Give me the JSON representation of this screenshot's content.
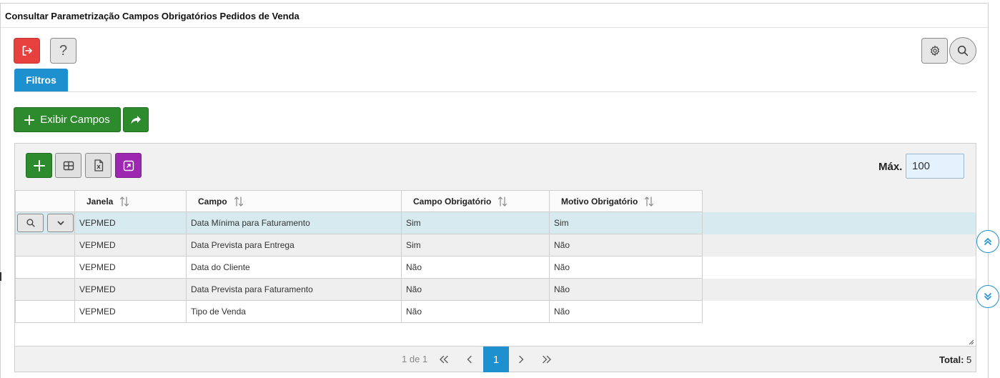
{
  "window": {
    "title": "Consultar Parametrização Campos Obrigatórios Pedidos de Venda"
  },
  "toolbar": {
    "exit_icon": "logout-icon",
    "help_label": "?",
    "settings_icon": "gear-icon",
    "search_icon": "search-icon",
    "exit_color": "#e8403c"
  },
  "tabs": [
    {
      "label": "Filtros",
      "active": true
    }
  ],
  "actions": {
    "show_fields_label": "Exibir Campos",
    "share_icon": "share-arrow-icon",
    "accent_green": "#2d8a2d"
  },
  "grid": {
    "toolbar_icons": [
      "plus-icon",
      "columns-icon",
      "excel-export-icon",
      "expand-icon"
    ],
    "max_label": "Máx.",
    "max_value": "100",
    "columns": [
      "Janela",
      "Campo",
      "Campo Obrigatório",
      "Motivo Obrigatório"
    ],
    "rows": [
      {
        "janela": "VEPMED",
        "campo": "Data Mínima para Faturamento",
        "campo_obrigatorio": "Sim",
        "motivo_obrigatorio": "Sim",
        "selected": true
      },
      {
        "janela": "VEPMED",
        "campo": "Data Prevista para Entrega",
        "campo_obrigatorio": "Sim",
        "motivo_obrigatorio": "Não"
      },
      {
        "janela": "VEPMED",
        "campo": "Data do Cliente",
        "campo_obrigatorio": "Não",
        "motivo_obrigatorio": "Não"
      },
      {
        "janela": "VEPMED",
        "campo": "Data Prevista para Faturamento",
        "campo_obrigatorio": "Não",
        "motivo_obrigatorio": "Não"
      },
      {
        "janela": "VEPMED",
        "campo": "Tipo de Venda",
        "campo_obrigatorio": "Não",
        "motivo_obrigatorio": "Não"
      }
    ],
    "selected_row_color": "#d6eaf0"
  },
  "pagination": {
    "info": "1 de 1",
    "current_page": "1",
    "total_label": "Total:",
    "total_value": "5",
    "accent": "#1e90cf"
  }
}
